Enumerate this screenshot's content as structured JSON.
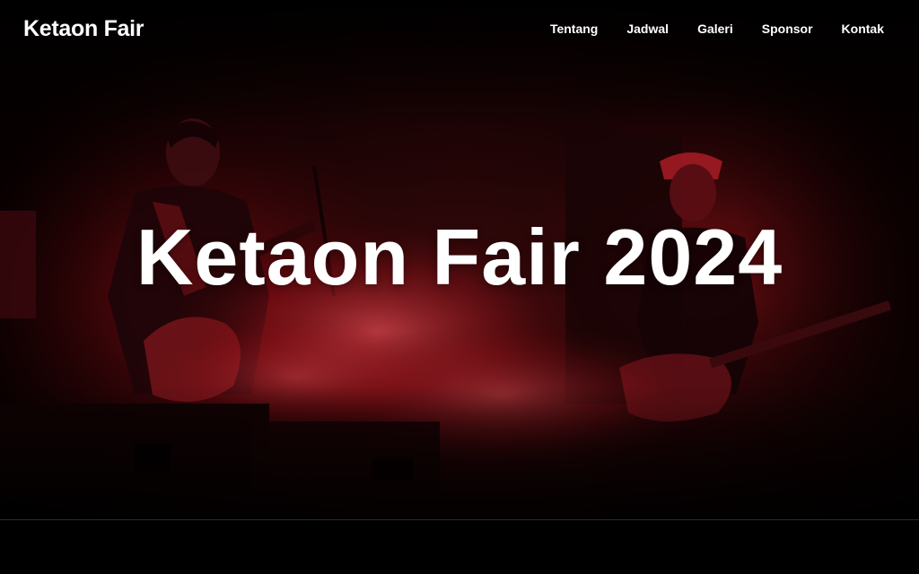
{
  "brand": {
    "name": "Ketaon Fair"
  },
  "nav": {
    "items": [
      {
        "label": "Tentang"
      },
      {
        "label": "Jadwal"
      },
      {
        "label": "Galeri"
      },
      {
        "label": "Sponsor"
      },
      {
        "label": "Kontak"
      }
    ]
  },
  "hero": {
    "title": "Ketaon Fair 2024",
    "background": "concert-band-red-stage-photo"
  },
  "colors": {
    "accent_red": "#c0121c",
    "background": "#000000",
    "text": "#ffffff"
  }
}
